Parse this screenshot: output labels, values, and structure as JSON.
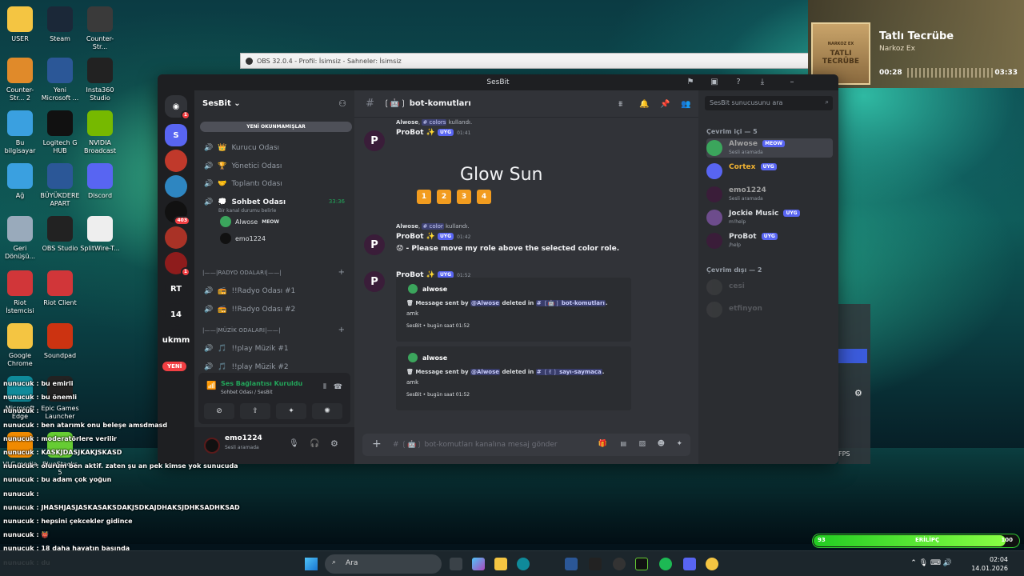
{
  "desktop": {
    "icons": [
      {
        "label": "USER",
        "icon": "folder-icon",
        "color": "#f4c542"
      },
      {
        "label": "Steam",
        "icon": "steam-icon",
        "color": "#1b2838"
      },
      {
        "label": "Counter-Str...",
        "icon": "cs-icon",
        "color": "#3a3a3a"
      },
      {
        "label": "Counter-Str... 2",
        "icon": "cs2-icon",
        "color": "#e08a2a"
      },
      {
        "label": "Yeni Microsoft ...",
        "icon": "word-icon",
        "color": "#2b5797"
      },
      {
        "label": "Insta360 Studio",
        "icon": "insta360-icon",
        "color": "#222"
      },
      {
        "label": "Bu bilgisayar",
        "icon": "computer-icon",
        "color": "#3aa0e0"
      },
      {
        "label": "Logitech G HUB",
        "icon": "logitech-icon",
        "color": "#111"
      },
      {
        "label": "NVIDIA Broadcast",
        "icon": "nvidia-icon",
        "color": "#76b900"
      },
      {
        "label": "Ağ",
        "icon": "network-icon",
        "color": "#3aa0e0"
      },
      {
        "label": "BÜYÜKDERE APART",
        "icon": "word-icon",
        "color": "#2b5797"
      },
      {
        "label": "Discord",
        "icon": "discord-icon",
        "color": "#5865f2"
      },
      {
        "label": "Geri Dönüşü...",
        "icon": "recycle-bin-icon",
        "color": "#9ab"
      },
      {
        "label": "OBS Studio",
        "icon": "obs-icon",
        "color": "#222"
      },
      {
        "label": "SplitWire-T...",
        "icon": "splitwire-icon",
        "color": "#eee"
      },
      {
        "label": "Riot İstemcisi",
        "icon": "riot-icon",
        "color": "#d13639"
      },
      {
        "label": "Riot Client",
        "icon": "riot-icon",
        "color": "#d13639"
      },
      {
        "label": "Google Chrome",
        "icon": "chrome-icon",
        "color": "#f4c542"
      },
      {
        "label": "Soundpad",
        "icon": "soundpad-icon",
        "color": "#c31"
      },
      {
        "label": "Microsoft Edge",
        "icon": "edge-icon",
        "color": "#0f8a9a"
      },
      {
        "label": "Epic Games Launcher",
        "icon": "epic-icon",
        "color": "#222"
      },
      {
        "label": "VLC media",
        "icon": "vlc-icon",
        "color": "#f08a00"
      },
      {
        "label": "BlueStacks 5",
        "icon": "bluestacks-icon",
        "color": "#6c3"
      }
    ]
  },
  "obs": {
    "title": "OBS 32.0.4 - Profil: İsimsiz - Sahneler: İsimsiz"
  },
  "music": {
    "cover_line1": "TATLI",
    "cover_line2": "TECRÜBE",
    "cover_top": "NARKOZ EX",
    "title": "Tatlı Tecrübe",
    "artist": "Narkoz Ex",
    "elapsed": "00:28",
    "duration": "03:33"
  },
  "discord": {
    "window_title": "SesBit",
    "server_name": "SesBit",
    "new_unread": "YENİ OKUNMAMIŞLAR",
    "yeni_badge": "YENİ",
    "servers": [
      {
        "label": "S",
        "color": "#5865f2",
        "badge": ""
      },
      {
        "label": "",
        "color": "#c0392b",
        "badge": ""
      },
      {
        "label": "",
        "color": "#2e86c1",
        "badge": ""
      },
      {
        "label": "",
        "color": "#111",
        "badge": "403"
      },
      {
        "label": "",
        "color": "#a93226",
        "badge": ""
      },
      {
        "label": "",
        "color": "#8e1c1c",
        "badge": "1"
      },
      {
        "label": "RT",
        "color": "#1e1f22",
        "badge": ""
      },
      {
        "label": "14",
        "color": "#1e1f22",
        "badge": ""
      },
      {
        "label": "ukmm",
        "color": "#1e1f22",
        "badge": ""
      }
    ],
    "channels": [
      {
        "name": "Kurucu Odası",
        "icon": "speaker-icon",
        "emoji": "👑"
      },
      {
        "name": "Yönetici Odası",
        "icon": "speaker-icon",
        "emoji": "🏆"
      },
      {
        "name": "Toplantı Odası",
        "icon": "speaker-icon",
        "emoji": "🤝"
      },
      {
        "name": "Sohbet Odası",
        "icon": "speaker-icon",
        "emoji": "💭",
        "active": true,
        "timer": "33:36",
        "status": "Bir kanal durumu belirle"
      }
    ],
    "voice_users": [
      {
        "name": "Alwose",
        "tag": "MEOW",
        "color": "#3ba55c"
      },
      {
        "name": "emo1224",
        "tag": "",
        "color": "#111"
      }
    ],
    "cat_radio": "|——|RADYO ODALARI|——|",
    "radio_channels": [
      {
        "name": "!!Radyo Odası #1"
      },
      {
        "name": "!!Radyo Odası #2"
      }
    ],
    "cat_music": "|——|MÜZİK ODALARI|——|",
    "music_channels": [
      {
        "name": "!!play Müzik #1"
      },
      {
        "name": "!!play Müzik #2"
      }
    ],
    "voice_panel": {
      "title": "Ses Bağlantısı Kuruldu",
      "sub": "Sohbet Odası / SesBit"
    },
    "user_panel": {
      "name": "emo1224",
      "status": "Sesli aramada"
    },
    "chat": {
      "channel": "bot-komutları",
      "messages": [
        {
          "reply_user": "Alwose",
          "reply_cmd": "# colors",
          "reply_text": "kullandı.",
          "author": "ProBot",
          "tag": "UYG",
          "time": "01:41"
        },
        {
          "big_text": "Glow Sun",
          "buttons": [
            "1",
            "2",
            "3",
            "4"
          ]
        },
        {
          "reply_user": "Alwose",
          "reply_cmd": "# color",
          "reply_text": "kullandı.",
          "author": "ProBot",
          "tag": "UYG",
          "time": "01:42",
          "text": "- Please move my role above the selected color role."
        },
        {
          "author": "ProBot",
          "tag": "UYG",
          "time": "01:52"
        }
      ],
      "embeds": [
        {
          "author": "alwose",
          "pre": "Message sent by",
          "mention": "@Alwose",
          "mid": "deleted in",
          "channel": "# ❲🤖❳ bot-komutları",
          "amk": "amk",
          "footer": "SesBit • bugün saat 01:52"
        },
        {
          "author": "alwose",
          "pre": "Message sent by",
          "mention": "@Alwose",
          "mid": "deleted in",
          "channel": "# ❲✌❳ sayı-saymaca",
          "amk": "amk",
          "footer": "SesBit • bugün saat 01:52"
        }
      ],
      "input_placeholder": "# ❲🤖❳ bot-komutları kanalına mesaj gönder"
    },
    "search_placeholder": "SesBit sunucusunu ara",
    "members_online_header": "Çevrim içi — 5",
    "members_online": [
      {
        "name": "Alwose",
        "tag": "MEOW",
        "status": "Sesli aramada",
        "color": "#a0a0a0"
      },
      {
        "name": "Cortex",
        "tag": "UYG",
        "status": "",
        "color": "#f0b232"
      },
      {
        "name": "emo1224",
        "tag": "",
        "status": "Sesli aramada",
        "color": "#a0a0a0"
      },
      {
        "name": "Jockie Music",
        "tag": "UYG",
        "status": "m!help",
        "color": "#dbdee1"
      },
      {
        "name": "ProBot",
        "tag": "UYG",
        "status": "/help",
        "color": "#dbdee1"
      }
    ],
    "members_offline_header": "Çevrim dışı — 2",
    "members_offline": [
      {
        "name": "cesi"
      },
      {
        "name": "etfinyon"
      }
    ]
  },
  "overlay_chat": [
    {
      "user": "nunucuk",
      "text": "bu emirli"
    },
    {
      "user": "nunucuk",
      "text": "bu önemli"
    },
    {
      "user": "nunucuk",
      "text": ""
    },
    {
      "user": "nunucuk",
      "text": "ben atarımk onu beleşe amsdmasd"
    },
    {
      "user": "nunucuk",
      "text": "moderatörlere verilir"
    },
    {
      "user": "nunucuk",
      "text": "KASKJDASJKAKJSKASD"
    },
    {
      "user": "nunucuk",
      "text": "olurum ben aktif. zaten şu an pek kimse yok sunucuda"
    },
    {
      "user": "nunucuk",
      "text": "bu adam çok yoğun"
    },
    {
      "user": "nunucuk",
      "text": ""
    },
    {
      "user": "nunucuk",
      "text": "JHASHJASJASKASAKSDAKJSDKAJDHAKSJDHKSADHKSAD"
    },
    {
      "user": "nunucuk",
      "text": "hepsini çekcekler gidince"
    },
    {
      "user": "nunucuk",
      "text": "👹"
    },
    {
      "user": "nunucuk",
      "text": "18 daha hayatın başında"
    },
    {
      "user": "nunucuk",
      "text": "du"
    }
  ],
  "xp_bar": {
    "left": "93",
    "center": "ERİLİPÇ",
    "right": "100",
    "progress": 0.93
  },
  "taskbar": {
    "search_placeholder": "Ara",
    "time": "02:04",
    "date": "14.01.2026"
  },
  "fps_label": "FPS"
}
